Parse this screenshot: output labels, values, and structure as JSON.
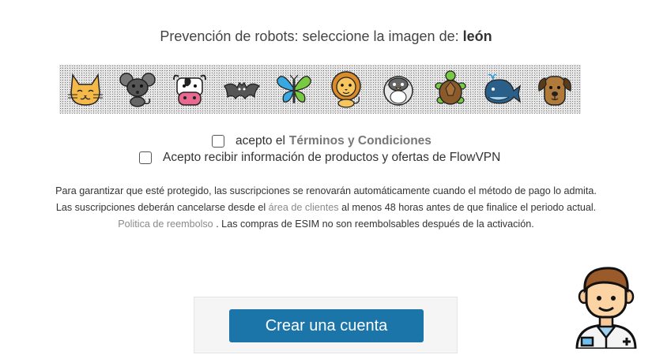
{
  "captcha": {
    "prompt": "Prevención de robots: seleccione la imagen de:",
    "target": "león",
    "images": [
      {
        "animal": "gato",
        "icon": "cat-icon"
      },
      {
        "animal": "ratón",
        "icon": "mouse-icon"
      },
      {
        "animal": "vaca",
        "icon": "cow-icon"
      },
      {
        "animal": "murciélago",
        "icon": "bat-icon"
      },
      {
        "animal": "mariposa",
        "icon": "butterfly-icon"
      },
      {
        "animal": "león",
        "icon": "lion-icon"
      },
      {
        "animal": "pingüino",
        "icon": "penguin-icon"
      },
      {
        "animal": "tortuga",
        "icon": "turtle-icon"
      },
      {
        "animal": "ballena",
        "icon": "whale-icon"
      },
      {
        "animal": "perro",
        "icon": "dog-icon"
      }
    ]
  },
  "checkboxes": {
    "terms_prefix": "acepto el",
    "terms_link": "Términos y Condiciones",
    "marketing": "Acepto recibir información de productos y ofertas de FlowVPN"
  },
  "info": {
    "line1": "Para garantizar que esté protegido, las suscripciones se renovarán automáticamente cuando el método de pago lo admita.",
    "line2_a": "Las suscripciones deberán cancelarse desde el",
    "line2_link": "área de clientes",
    "line2_b": "al menos 48 horas antes de que finalice el periodo actual.",
    "line3_link": "Politica de reembolso",
    "line3_b": ". Las compras de ESIM no son reembolsables después de la activación."
  },
  "button": {
    "label": "Crear una cuenta"
  },
  "colors": {
    "button": "#1b75a8",
    "link": "#8a8a8a"
  }
}
